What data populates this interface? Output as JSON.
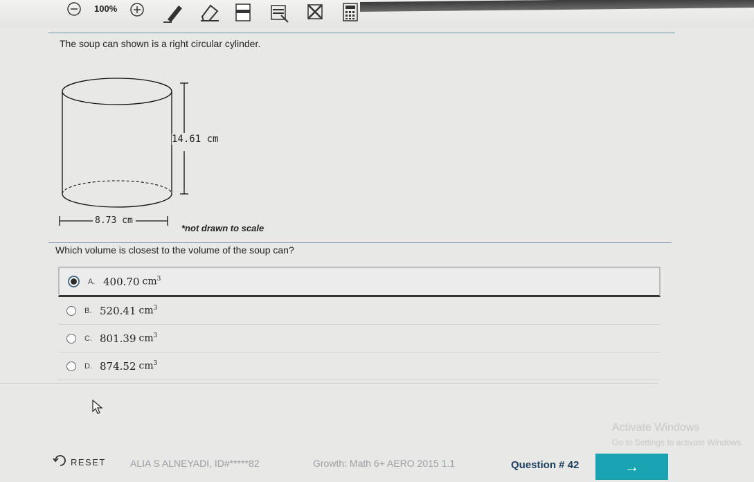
{
  "toolbar": {
    "zoom_level": "100%",
    "tools": [
      "zoom-out-icon",
      "zoom-in-icon",
      "pencil-icon",
      "eraser-icon",
      "line-reader-icon",
      "highlighter-icon",
      "answer-eliminator-icon",
      "calculator-icon"
    ]
  },
  "question": {
    "stem": "The soup can shown is a right circular cylinder.",
    "figure": {
      "height_label": "14.61 cm",
      "diameter_label": "8.73 cm",
      "note": "*not drawn to scale"
    },
    "prompt": "Which volume is closest to the volume of the soup can?",
    "choices": [
      {
        "letter": "A.",
        "value": "400.70",
        "unit": "cm",
        "exponent": "3",
        "selected": true
      },
      {
        "letter": "B.",
        "value": "520.41",
        "unit": "cm",
        "exponent": "3",
        "selected": false
      },
      {
        "letter": "C.",
        "value": "801.39",
        "unit": "cm",
        "exponent": "3",
        "selected": false
      },
      {
        "letter": "D.",
        "value": "874.52",
        "unit": "cm",
        "exponent": "3",
        "selected": false
      }
    ]
  },
  "watermark": {
    "line1": "Activate Windows",
    "line2": "Go to Settings to activate Windows"
  },
  "footer": {
    "reset_label": "RESET",
    "student": "ALIA S ALNEYADI, ID#*****82",
    "test_name": "Growth: Math 6+ AERO 2015 1.1",
    "question_number": "Question # 42",
    "next_label": "→"
  },
  "colors": {
    "accent": "#1aa3b3",
    "question_number": "#1d3f5e",
    "background": "#e8e8e6"
  }
}
